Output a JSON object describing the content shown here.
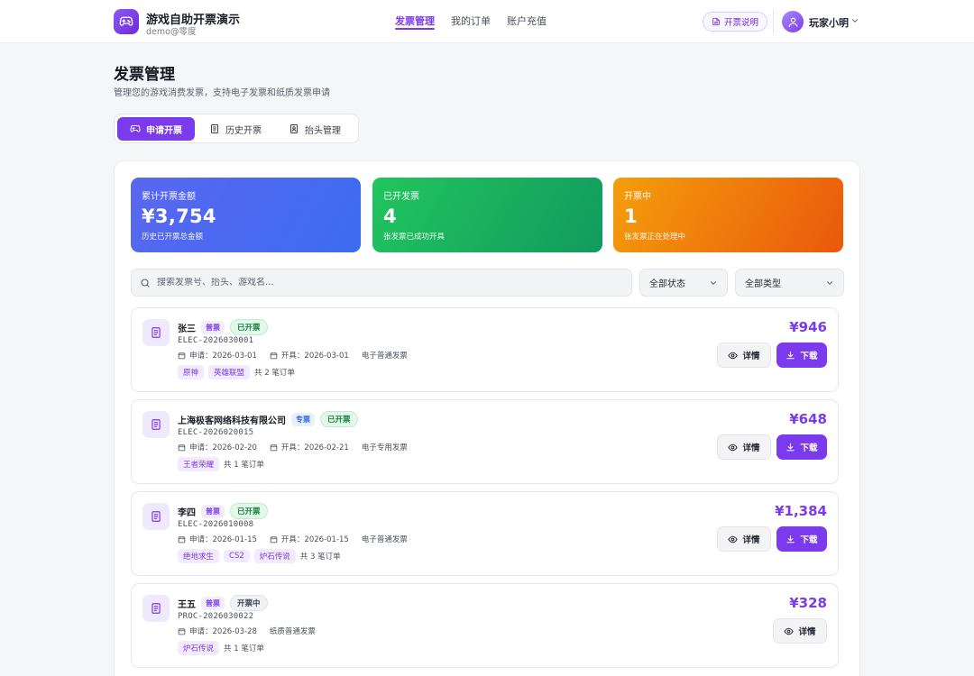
{
  "app": {
    "title": "游戏自助开票演示",
    "subtitle": "demo@零度"
  },
  "nav": [
    {
      "label": "发票管理",
      "active": true
    },
    {
      "label": "我的订单",
      "active": false
    },
    {
      "label": "账户充值",
      "active": false
    }
  ],
  "header": {
    "help_label": "开票说明",
    "user_name": "玩家小明"
  },
  "page": {
    "title": "发票管理",
    "description": "管理您的游戏消费发票，支持电子发票和纸质发票申请"
  },
  "tabs": [
    {
      "label": "申请开票",
      "icon": "gamepad-icon",
      "active": true
    },
    {
      "label": "历史开票",
      "icon": "document-icon",
      "active": false
    },
    {
      "label": "抬头管理",
      "icon": "id-card-icon",
      "active": false
    }
  ],
  "stats": [
    {
      "label": "累计开票金额",
      "value": "¥3,754",
      "note": "历史已开票总金额",
      "color": "#4f68f0"
    },
    {
      "label": "已开发票",
      "value": "4",
      "note": "张发票已成功开具",
      "color": "#16a34a"
    },
    {
      "label": "开票中",
      "value": "1",
      "note": "张发票正在处理中",
      "color": "#f07a0b"
    }
  ],
  "filters": {
    "search_placeholder": "搜索发票号、抬头、游戏名...",
    "status": "全部状态",
    "type": "全部类型"
  },
  "invoices": [
    {
      "name": "张三",
      "kind": "普票",
      "status": "已开票",
      "number": "ELEC-2026030001",
      "apply": "申请：2026-03-01",
      "issue": "开具：2026-03-01",
      "category": "电子普通发票",
      "games": [
        "原神",
        "英雄联盟"
      ],
      "count": "共 2 笔订单",
      "amount": "¥946",
      "detail_label": "详情",
      "download_label": "下载"
    },
    {
      "name": "上海极客网络科技有限公司",
      "kind": "专票",
      "status": "已开票",
      "number": "ELEC-2026020015",
      "apply": "申请：2026-02-20",
      "issue": "开具：2026-02-21",
      "category": "电子专用发票",
      "games": [
        "王者荣耀"
      ],
      "count": "共 1 笔订单",
      "amount": "¥648",
      "detail_label": "详情",
      "download_label": "下载"
    },
    {
      "name": "李四",
      "kind": "普票",
      "status": "已开票",
      "number": "ELEC-2026010008",
      "apply": "申请：2026-01-15",
      "issue": "开具：2026-01-15",
      "category": "电子普通发票",
      "games": [
        "绝地求生",
        "CS2",
        "炉石传说"
      ],
      "count": "共 3 笔订单",
      "amount": "¥1,384",
      "detail_label": "详情",
      "download_label": "下载"
    },
    {
      "name": "王五",
      "kind": "普票",
      "status": "开票中",
      "number": "PROC-2026030022",
      "apply": "申请：2026-03-28",
      "category": "纸质普通发票",
      "games": [
        "炉石传说"
      ],
      "count": "共 1 笔订单",
      "amount": "¥328",
      "detail_label": "详情"
    }
  ],
  "colors": {
    "accent": "#7c3aed",
    "done": "#15803d",
    "special": "#2563eb"
  }
}
